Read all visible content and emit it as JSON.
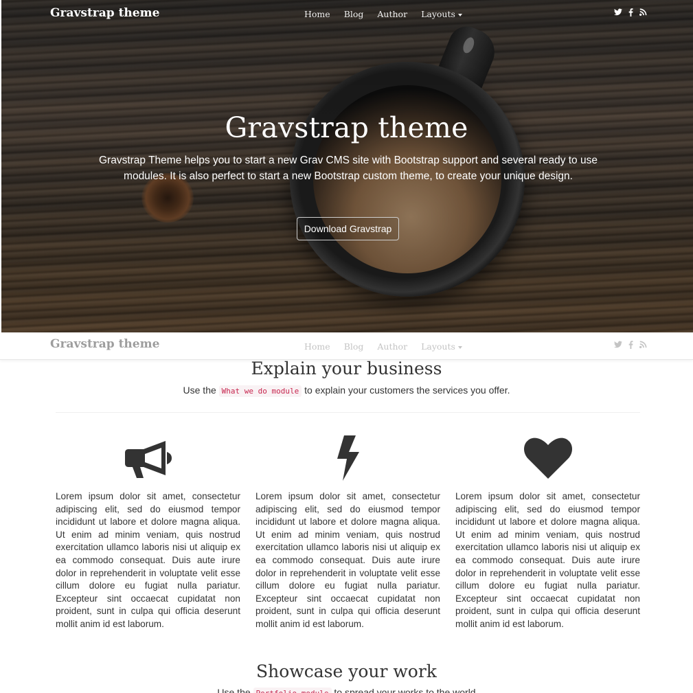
{
  "navbar": {
    "brand": "Gravstrap theme",
    "links": [
      "Home",
      "Blog",
      "Author",
      "Layouts"
    ],
    "social_icons": [
      "twitter-icon",
      "facebook-icon",
      "rss-icon"
    ]
  },
  "hero": {
    "title": "Gravstrap theme",
    "description": "Gravstrap Theme helps you to start a new Grav CMS site with Bootstrap support and several ready to use modules. It is also perfect to start a new Bootstrap custom theme, to create your unique design.",
    "button_label": "Download Gravstrap"
  },
  "business": {
    "title": "Explain your business",
    "sub_before": "Use the ",
    "sub_code": "What we do module",
    "sub_after": " to explain your customers the services you offer.",
    "columns": [
      {
        "icon": "bullhorn-icon",
        "text": "Lorem ipsum dolor sit amet, consectetur adipiscing elit, sed do eiusmod tempor incididunt ut labore et dolore magna aliqua. Ut enim ad minim veniam, quis nostrud exercitation ullamco laboris nisi ut aliquip ex ea commodo consequat. Duis aute irure dolor in reprehenderit in voluptate velit esse cillum dolore eu fugiat nulla pariatur. Excepteur sint occaecat cupidatat non proident, sunt in culpa qui officia deserunt mollit anim id est laborum."
      },
      {
        "icon": "bolt-icon",
        "text": "Lorem ipsum dolor sit amet, consectetur adipiscing elit, sed do eiusmod tempor incididunt ut labore et dolore magna aliqua. Ut enim ad minim veniam, quis nostrud exercitation ullamco laboris nisi ut aliquip ex ea commodo consequat. Duis aute irure dolor in reprehenderit in voluptate velit esse cillum dolore eu fugiat nulla pariatur. Excepteur sint occaecat cupidatat non proident, sunt in culpa qui officia deserunt mollit anim id est laborum."
      },
      {
        "icon": "heart-icon",
        "text": "Lorem ipsum dolor sit amet, consectetur adipiscing elit, sed do eiusmod tempor incididunt ut labore et dolore magna aliqua. Ut enim ad minim veniam, quis nostrud exercitation ullamco laboris nisi ut aliquip ex ea commodo consequat. Duis aute irure dolor in reprehenderit in voluptate velit esse cillum dolore eu fugiat nulla pariatur. Excepteur sint occaecat cupidatat non proident, sunt in culpa qui officia deserunt mollit anim id est laborum."
      }
    ]
  },
  "showcase": {
    "title": "Showcase your work",
    "sub_before": "Use the ",
    "sub_code": "Portfolio module",
    "sub_after": " to spread your works to the world"
  }
}
